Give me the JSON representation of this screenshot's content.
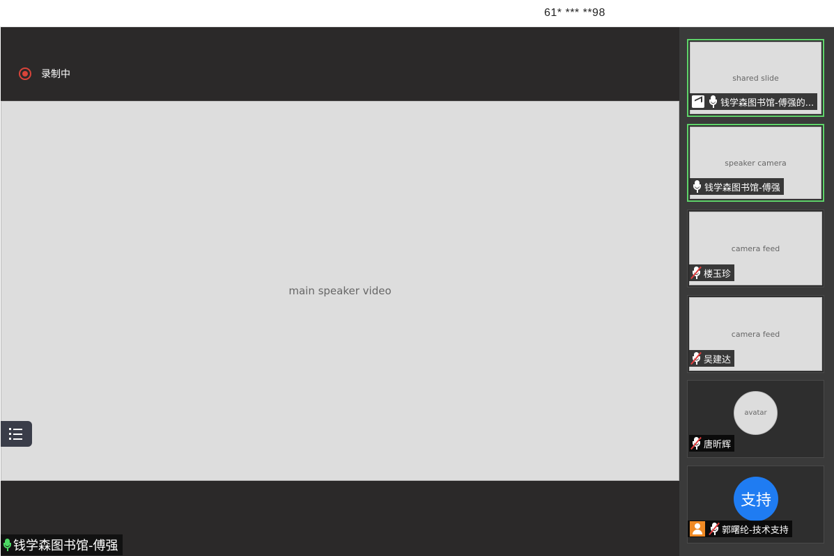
{
  "meeting_id": "61* *** **98",
  "recording": {
    "label": "录制中"
  },
  "main_video": {
    "placeholder": "main speaker video",
    "speaker_name": "钱学森图书馆-傅强"
  },
  "participants": [
    {
      "name": "钱学森图书馆-傅强的...",
      "placeholder": "shared slide",
      "sharing": true,
      "mic": "on"
    },
    {
      "name": "钱学森图书馆-傅强",
      "placeholder": "speaker camera",
      "mic": "on"
    },
    {
      "name": "楼玉珍",
      "placeholder": "camera feed",
      "mic": "muted"
    },
    {
      "name": "吴建达",
      "placeholder": "camera feed",
      "mic": "muted"
    },
    {
      "name": "唐昕辉",
      "placeholder": "avatar",
      "mic": "muted"
    },
    {
      "name": "郭曙纶-技术支持",
      "avatar_text": "支持",
      "mic": "muted"
    }
  ]
}
